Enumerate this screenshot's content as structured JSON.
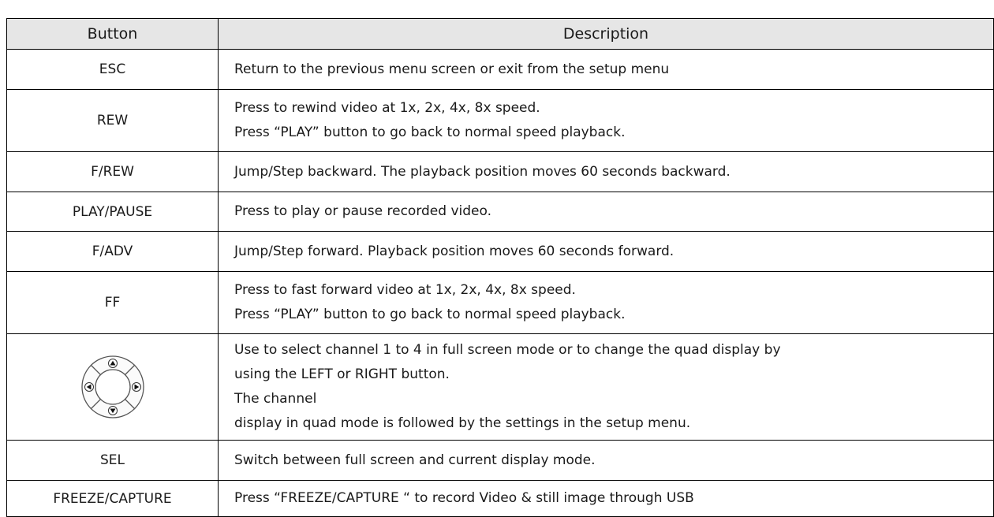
{
  "table": {
    "headers": {
      "button": "Button",
      "description": "Description"
    },
    "rows": [
      {
        "button": "ESC",
        "description": [
          "Return to the previous menu screen or exit from the setup menu"
        ]
      },
      {
        "button": "REW",
        "description": [
          "Press to rewind video at 1x, 2x, 4x, 8x speed.",
          "Press “PLAY” button to go back to normal speed playback."
        ]
      },
      {
        "button": "F/REW",
        "description": [
          "Jump/Step backward. The playback position moves 60 seconds backward."
        ]
      },
      {
        "button": "PLAY/PAUSE",
        "description": [
          "Press to play or pause recorded video."
        ]
      },
      {
        "button": "F/ADV",
        "description": [
          "Jump/Step forward. Playback position moves 60 seconds forward."
        ]
      },
      {
        "button": "FF",
        "description": [
          "Press to fast forward video at 1x, 2x, 4x, 8x speed.",
          "Press “PLAY” button to go back to normal speed playback."
        ]
      },
      {
        "button_icon": "direction-pad-icon",
        "description": [
          "Use to select channel 1 to 4 in full screen mode or to change the quad display by",
          "using the LEFT or RIGHT button.",
          "The channel",
          "display in quad mode is followed by the settings in the setup menu."
        ]
      },
      {
        "button": "SEL",
        "description": [
          "Switch between full screen and current display mode."
        ]
      },
      {
        "button": "FREEZE/CAPTURE",
        "description": [
          "Press “FREEZE/CAPTURE “ to record Video & still image through USB"
        ]
      }
    ]
  }
}
